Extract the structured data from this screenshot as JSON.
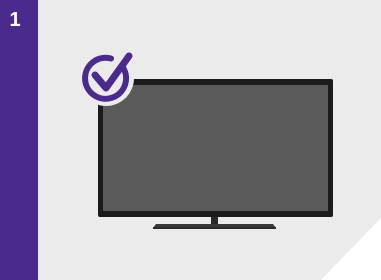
{
  "step": {
    "number": "1"
  },
  "colors": {
    "accent": "#4a2a8c",
    "card_background": "#ebebeb",
    "tv_frame": "#1b1b1b",
    "tv_screen": "#5a5a5a"
  },
  "icons": {
    "check": "check-circle-icon",
    "tv": "television-icon"
  }
}
